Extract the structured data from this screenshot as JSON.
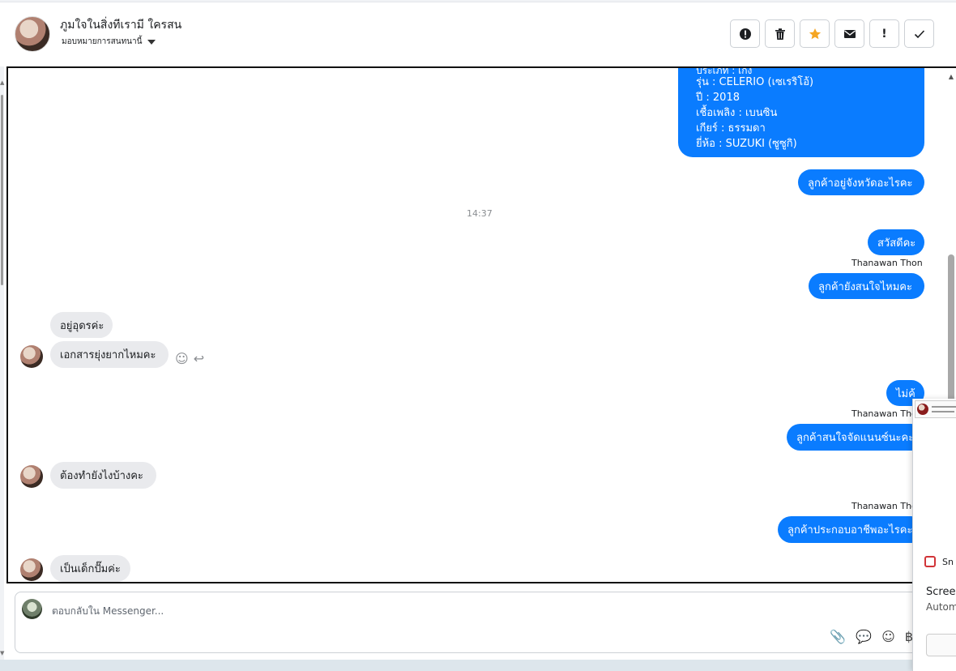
{
  "header": {
    "contact_name": "ภูมใจในสิ่งทีเรามี ใครสน",
    "assign_label": "มอบหมายการสนทนานี้",
    "actions": [
      {
        "name": "alert-circle",
        "glyph": "!"
      },
      {
        "name": "trash",
        "glyph": "🗑"
      },
      {
        "name": "star",
        "glyph": "★"
      },
      {
        "name": "mail",
        "glyph": "✉"
      },
      {
        "name": "exclaim",
        "glyph": "!"
      },
      {
        "name": "check",
        "glyph": "✓"
      }
    ]
  },
  "chat": {
    "car_details": [
      "ประเภท : เก๋ง",
      "รุ่น : CELERIO (เซเรริโอ้)",
      "ปี : 2018",
      "เชื้อเพลิง : เบนซิน",
      "เกียร์ : ธรรมดา",
      "ยี่ห้อ : SUZUKI (ซูซูกิ)"
    ],
    "out_1": "ลูกค้าอยู่จังหวัดอะไรคะ",
    "timestamp": "14:37",
    "out_2": "สวัสดีคะ",
    "sender_1": "Thanawan Thon",
    "out_3": "ลูกค้ายังสนใจไหมคะ",
    "in_1": "อยู่อุดรค่ะ",
    "in_2": "เอกสารยุ่งยากไหมคะ",
    "out_4": "ไม่ค้",
    "sender_2": "Thanawan Thon",
    "out_5": "ลูกค้าสนใจจัดแนนซ์นะคะ",
    "in_3": "ต้องทำยังไงบ้างคะ",
    "sender_3": "Thanawan Thon",
    "out_6": "ลูกค้าประกอบอาชีพอะไรคะ",
    "in_4": "เป็นเด็กปั๊มค่ะ"
  },
  "composer": {
    "placeholder": "ตอบกลับใน Messenger..."
  },
  "popup": {
    "snip_label": "Sn",
    "title": "Screer",
    "subtitle": "Autom"
  },
  "colors": {
    "outgoing": "#0a7cff",
    "incoming": "#e9eaed",
    "star": "#f5a623"
  }
}
